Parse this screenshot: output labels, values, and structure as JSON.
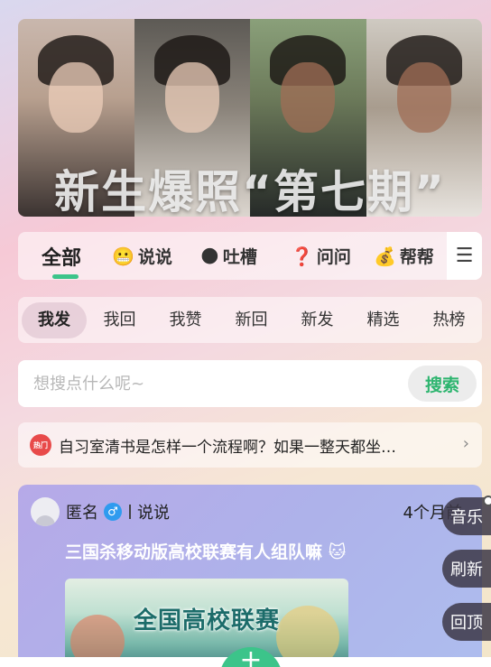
{
  "banner": {
    "title": "新生爆照“第七期”"
  },
  "categories": [
    {
      "label": "全部",
      "emoji": ""
    },
    {
      "label": "说说",
      "emoji": "😬"
    },
    {
      "label": "吐槽",
      "emoji": "🌑"
    },
    {
      "label": "问问",
      "emoji": "❓"
    },
    {
      "label": "帮帮",
      "emoji": "💰"
    }
  ],
  "menu_icon": "☰",
  "subtabs": [
    "我发",
    "我回",
    "我赞",
    "新回",
    "新发",
    "精选",
    "热榜"
  ],
  "search": {
    "placeholder": "想搜点什么呢~",
    "button": "搜索"
  },
  "hot": {
    "badge": "热门",
    "text": "自习室清书是怎样一个流程啊？如果一整天都坐…",
    "chevron": "›"
  },
  "post": {
    "author": "匿名",
    "gender_icon": "♂",
    "type": "说说",
    "time": "4个月前",
    "title": "三国杀移动版高校联赛有人组队嘛 🐱",
    "image_text": "全国高校联赛"
  },
  "float_buttons": {
    "music": "音乐",
    "refresh": "刷新",
    "top": "回顶"
  },
  "fab_icon": "+",
  "colors": {
    "accent": "#3cc48a",
    "search_btn_text": "#2db56f",
    "hot_icon": "#e84a4a",
    "gender": "#2f9bef"
  }
}
